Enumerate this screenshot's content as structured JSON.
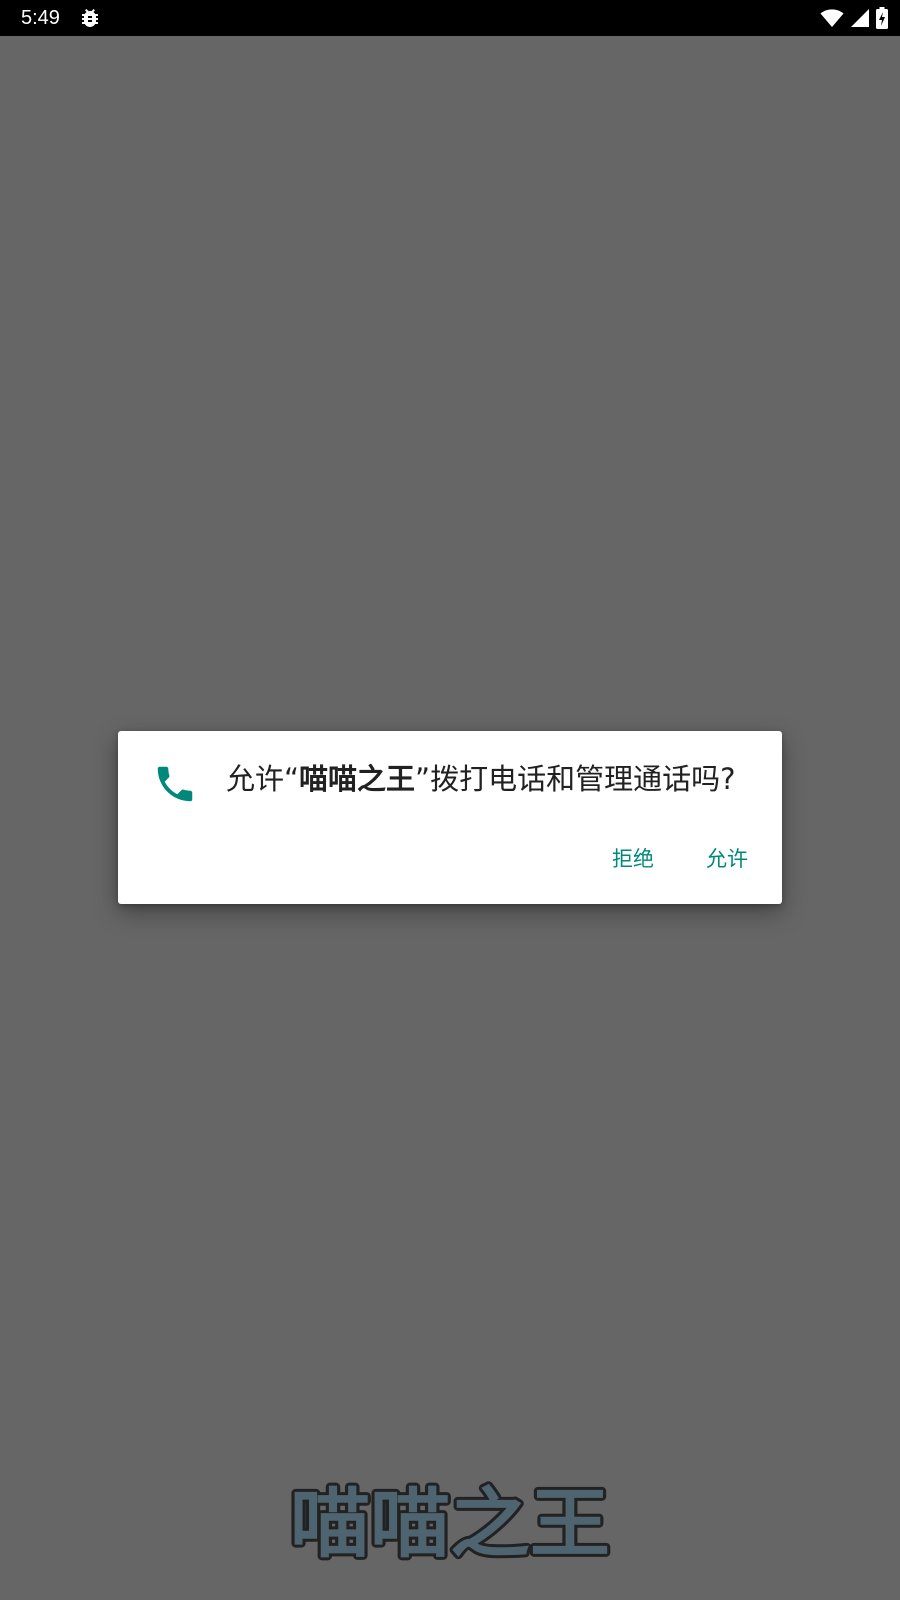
{
  "status_bar": {
    "time": "5:49",
    "left_icons": [
      "bug-icon"
    ],
    "right_icons": [
      "wifi-icon",
      "cell-signal-icon",
      "battery-charging-icon"
    ]
  },
  "dialog": {
    "icon": "phone-icon",
    "message_prefix": "允许“",
    "app_name": "喵喵之王",
    "message_suffix": "”拨打电话和管理通话吗?",
    "deny_label": "拒绝",
    "allow_label": "允许",
    "accent_color": "#00897b"
  },
  "splash": {
    "logo_text": "喵喵之王",
    "logo_fill": "#4e6470",
    "logo_outline": "#222222"
  },
  "colors": {
    "overlay_background": "#666666",
    "dialog_background": "#ffffff",
    "status_bar_background": "#000000"
  }
}
